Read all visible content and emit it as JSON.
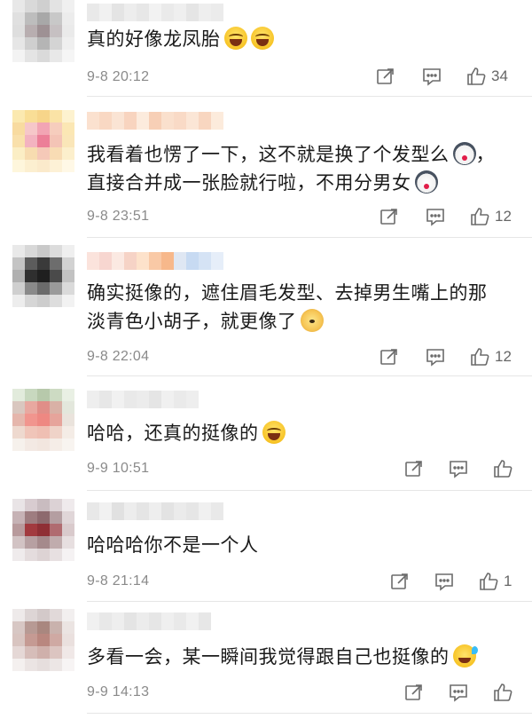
{
  "icons": {
    "share": "share-icon",
    "comment": "comment-icon",
    "like": "thumbs-up-icon"
  },
  "colors": {
    "text": "#1a1a1a",
    "meta": "#8a8a8a",
    "icon": "#666666",
    "divider": "#e6e6e6"
  },
  "comments": [
    {
      "lines": [
        {
          "text": "真的好像龙凤胎",
          "emojis": [
            "laugh-emoji",
            "laugh-emoji"
          ]
        }
      ],
      "time": "9-8 20:12",
      "likes": "34",
      "avatar_colors": [
        "#e8e8e8",
        "#d9d9d9",
        "#cfcfcf",
        "#e3e3e3",
        "#f0f0f0",
        "#e0e0e0",
        "#bdbdbd",
        "#a8a8a8",
        "#c8c8c8",
        "#ececec",
        "#dedede",
        "#b8aeb0",
        "#9e9194",
        "#c6c0c2",
        "#eaeaea",
        "#e6e6e6",
        "#cfcfcf",
        "#b5b5b5",
        "#d4d4d4",
        "#efefef",
        "#f3f3f3",
        "#e4e4e4",
        "#dadada",
        "#e8e8e8",
        "#f5f5f5"
      ],
      "name_colors": [
        "#e9e9e9",
        "#f1f1f1",
        "#e4e4e4",
        "#ededed",
        "#e7e7e7",
        "#f2f2f2",
        "#eaeaea",
        "#efefef",
        "#e5e5e5",
        "#eeeeee",
        "#ebebeb"
      ]
    },
    {
      "lines": [
        {
          "text": "我看着也愣了一下，这不就是换了个发型么",
          "emojis": [
            "husky-emoji"
          ],
          "suffix": "，"
        },
        {
          "text": "直接合并成一张脸就行啦，不用分男女",
          "emojis": [
            "husky-emoji"
          ]
        }
      ],
      "time": "9-8 23:51",
      "likes": "12",
      "avatar_colors": [
        "#fbe9b0",
        "#f9de96",
        "#f7d58a",
        "#fae3a6",
        "#fdf2cf",
        "#f8dba0",
        "#f6c7c9",
        "#f2a5b4",
        "#f6cdbd",
        "#fbe7b4",
        "#f9e0ab",
        "#f3b3c0",
        "#ec7f98",
        "#f4c4b6",
        "#fae6b8",
        "#fbeec5",
        "#f7dcb0",
        "#f5c9b8",
        "#f8dcb4",
        "#fcefcc",
        "#fef6dc",
        "#fcefd0",
        "#fbeacb",
        "#fdf1d6",
        "#fff8e6"
      ],
      "name_colors": [
        "#fbe1cf",
        "#f9d8c3",
        "#fae4d4",
        "#f8d4bf",
        "#fcebdd",
        "#f7cfb6",
        "#fae0cd",
        "#f9dac6",
        "#fbe6d6",
        "#f8d6c0",
        "#fcebdc"
      ]
    },
    {
      "lines": [
        {
          "text": "确实挺像的，遮住眉毛发型、去掉男生嘴上的那",
          "emojis": []
        },
        {
          "text": "淡青色小胡子，就更像了",
          "emojis": [
            "dog-emoji"
          ]
        }
      ],
      "time": "9-8 22:04",
      "likes": "12",
      "avatar_colors": [
        "#e9e9e9",
        "#d8d8d8",
        "#c9c9c9",
        "#dcdcdc",
        "#efefef",
        "#c4c4c4",
        "#5c5c5c",
        "#3a3a3a",
        "#6d6d6d",
        "#d2d2d2",
        "#b0b0b0",
        "#2f2f2f",
        "#1f1f1f",
        "#4a4a4a",
        "#c2c2c2",
        "#cfcfcf",
        "#8a8a8a",
        "#6b6b6b",
        "#9a9a9a",
        "#dadada",
        "#ededed",
        "#d6d6d6",
        "#cdcdcd",
        "#dddddd",
        "#f2f2f2"
      ],
      "name_colors": [
        "#fbe3dc",
        "#f7d6d0",
        "#fbe9e2",
        "#f6d3c6",
        "#fde2cb",
        "#f9c9a6",
        "#f7b88b",
        "#dfe7f3",
        "#c7daf2",
        "#d5e3f5",
        "#e6eef9"
      ]
    },
    {
      "lines": [
        {
          "text": "哈哈，还真的挺像的",
          "emojis": [
            "laugh-emoji"
          ]
        }
      ],
      "time": "9-9 10:51",
      "likes": "",
      "avatar_colors": [
        "#e2ebdc",
        "#c8d8bf",
        "#b7c9ab",
        "#cddbc3",
        "#e9f0e4",
        "#d9c7bf",
        "#e8a8a0",
        "#e08e88",
        "#d9b1a6",
        "#e3e7dc",
        "#e5b6ac",
        "#f1958e",
        "#ee8882",
        "#e6a49b",
        "#eae3dc",
        "#eed9cf",
        "#f0c5b9",
        "#efbfb3",
        "#efd3c8",
        "#f4ece6",
        "#f6f1ec",
        "#f3e9e3",
        "#f2e6df",
        "#f5ede7",
        "#f8f4f0"
      ],
      "name_colors": [
        "#eeeeee",
        "#e7e7e7",
        "#f1f1f1",
        "#e9e9e9",
        "#ececec",
        "#e5e5e5",
        "#f0f0f0",
        "#eaeaea",
        "#eeeeee"
      ]
    },
    {
      "lines": [
        {
          "text": "哈哈哈你不是一个人",
          "emojis": []
        }
      ],
      "time": "9-8 21:14",
      "likes": "1",
      "avatar_colors": [
        "#e9e4e6",
        "#d8ccd0",
        "#c9bcc0",
        "#dcd2d5",
        "#efeaec",
        "#c6b2b5",
        "#9e7d80",
        "#8d6a6e",
        "#b49ea1",
        "#e0d6d8",
        "#b89a9c",
        "#a23a3f",
        "#8f2f35",
        "#b06b70",
        "#d9cacc",
        "#d2c3c4",
        "#b7a0a2",
        "#a58a8c",
        "#c0acad",
        "#e7dfe0",
        "#efebec",
        "#e4dcdd",
        "#ddd3d4",
        "#e7e0e1",
        "#f5f2f3"
      ],
      "name_colors": [
        "#e8e8e8",
        "#f1f1f1",
        "#e1e1e1",
        "#ededed",
        "#e5e5e5",
        "#eeeeee",
        "#e3e3e3",
        "#ebebeb",
        "#e6e6e6",
        "#f0f0f0",
        "#e9e9e9"
      ]
    },
    {
      "lines": [
        {
          "text": "多看一会，某一瞬间我觉得跟自己也挺像的",
          "emojis": [
            "sweat-emoji"
          ]
        }
      ],
      "time": "9-9 14:13",
      "likes": "",
      "avatar_colors": [
        "#eeeaea",
        "#ddd5d5",
        "#d3c9c9",
        "#e1d9d9",
        "#f2efef",
        "#d7c7c4",
        "#b79a94",
        "#a9877f",
        "#c9b2ad",
        "#ebe4e2",
        "#d8c4c0",
        "#c59a93",
        "#b9877f",
        "#cfa9a3",
        "#eae0de",
        "#e5d8d6",
        "#d6bdb9",
        "#cfb0ab",
        "#dcc5c1",
        "#f0e8e7",
        "#f4f0ef",
        "#ebe4e3",
        "#e6dedd",
        "#ece6e5",
        "#f7f4f4"
      ],
      "name_colors": [
        "#f0f0f0",
        "#e8e8e8",
        "#eeeeee",
        "#e4e4e4",
        "#ececec",
        "#e6e6e6",
        "#efefef",
        "#e9e9e9",
        "#f1f1f1",
        "#e7e7e7"
      ]
    }
  ]
}
